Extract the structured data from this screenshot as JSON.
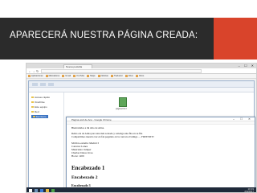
{
  "slide": {
    "title": "APARECERÁ NUESTRA PÁGINA CREADA:"
  },
  "colors": {
    "banner_dark": "#2b2b2b",
    "banner_accent": "#d9442b"
  },
  "browser": {
    "tab_label": "Nueva pestaña",
    "url_text": "",
    "bookmarks": [
      {
        "icon": "bookmark-icon",
        "label": "Aplicaciones"
      },
      {
        "icon": "bookmark-icon",
        "label": "Marcadores"
      },
      {
        "icon": "bookmark-icon",
        "label": "Gmail"
      },
      {
        "icon": "bookmark-icon",
        "label": "YouTube"
      },
      {
        "icon": "bookmark-icon",
        "label": "Maps"
      },
      {
        "icon": "bookmark-icon",
        "label": "Noticias"
      },
      {
        "icon": "bookmark-icon",
        "label": "Traductor"
      },
      {
        "icon": "bookmark-icon",
        "label": "Drive"
      },
      {
        "icon": "bookmark-icon",
        "label": "Otros"
      }
    ]
  },
  "explorer": {
    "sidebar": [
      {
        "label": "Acceso rápido"
      },
      {
        "label": "OneDrive"
      },
      {
        "label": "Este equipo"
      },
      {
        "label": "Red"
      },
      {
        "label": "Escritorio"
      }
    ],
    "file_label": "pagina.html"
  },
  "notepad": {
    "title": "Página web de Ana - Google Chrome",
    "lines": [
      "Bienvenidos a mi sitio de Atina.",
      "",
      "Reina ola de Atina para una más soleada y sobetiga una fila en su fila",
      "Compartimos nuestra vez en fan pegando en la cual en el lamigo — FREESITE!",
      "",
      "Mi libro estrella: Madrid 3",
      "Carteras: Lunes",
      "Materiales: Jumper",
      "Charlas: Datos vivos",
      "Ha de: 1209"
    ],
    "heading1": "Encabezado 1",
    "heading2": "Encabezado 2",
    "heading3": "Encabezado 3"
  },
  "taskbar": {
    "time": "10:19",
    "date": "2/4/2017"
  }
}
